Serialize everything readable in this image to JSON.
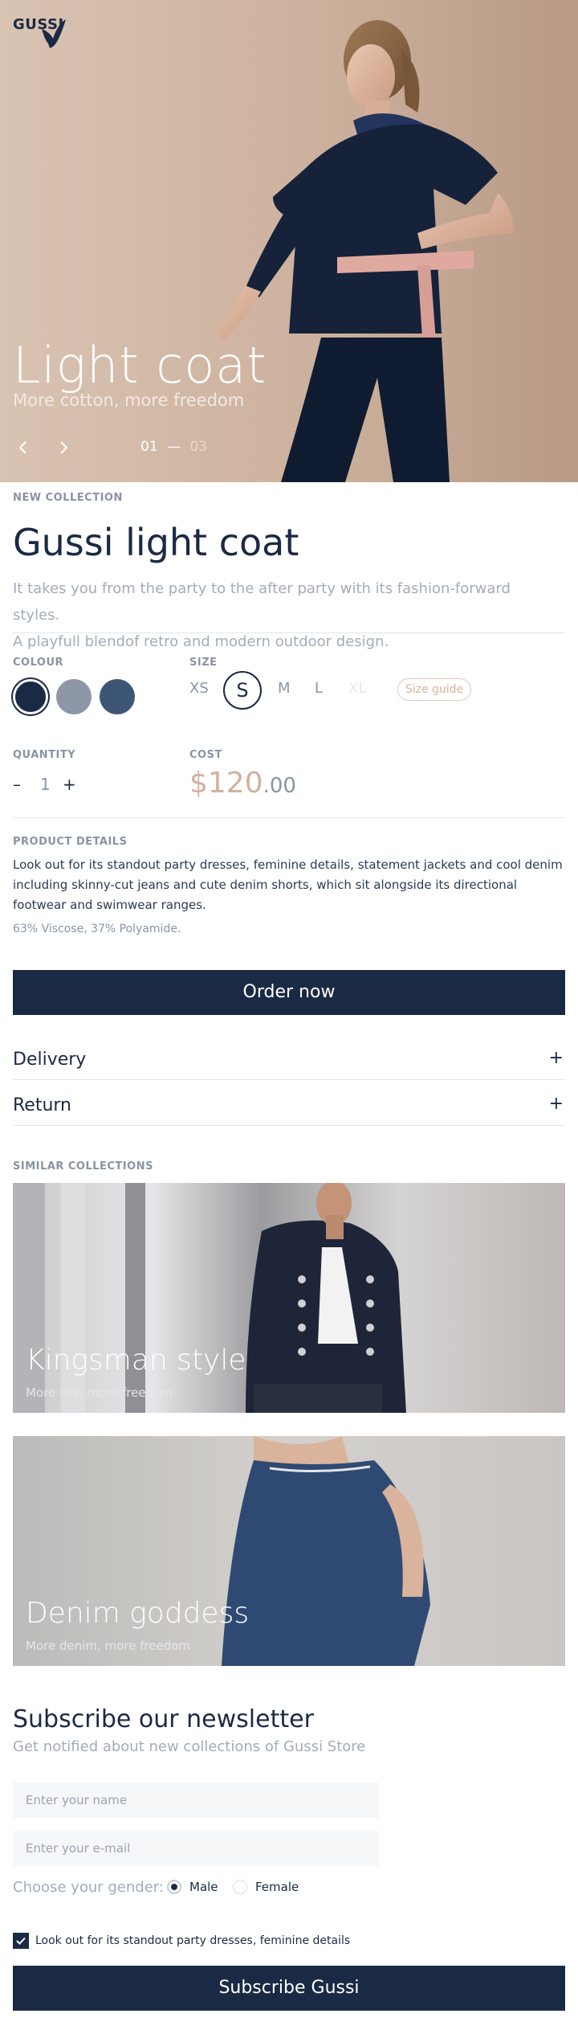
{
  "brand": {
    "name": "GUSSI"
  },
  "hero": {
    "title": "Light coat",
    "subtitle": "More cotton, more freedom",
    "current": "01",
    "separator": "—",
    "total": "03",
    "prev_icon": "chevron-left-icon",
    "next_icon": "chevron-right-icon"
  },
  "product": {
    "collection_label": "NEW COLLECTION",
    "title": "Gussi light coat",
    "description_1": "It takes you from the party to the after party  with its fashion-forward styles.",
    "description_2": "A playfull blendof retro and modern outdoor design."
  },
  "colour": {
    "label": "COLOUR",
    "swatches": [
      "#1b2a44",
      "#8e97a8",
      "#3e5675"
    ],
    "selected_index": 0
  },
  "size": {
    "label": "SIZE",
    "options": [
      "XS",
      "S",
      "M",
      "L",
      "XL"
    ],
    "selected": "S",
    "disabled": [
      "XL"
    ],
    "guide_label": "Size guide"
  },
  "quantity": {
    "label": "QUANTITY",
    "minus": "–",
    "value": "1",
    "plus": "+"
  },
  "cost": {
    "label": "COST",
    "main": "$120",
    "cents": ".00"
  },
  "details": {
    "label": "PRODUCT DETAILS",
    "text": "Look out for its standout party dresses, feminine details, statement jackets and cool denim including skinny-cut jeans and cute denim shorts, which sit alongside its directional footwear and swimwear ranges.",
    "material": "63% Viscose, 37% Polyamide."
  },
  "order_button": "Order now",
  "accordion": [
    {
      "title": "Delivery",
      "icon": "+"
    },
    {
      "title": "Return",
      "icon": "+"
    }
  ],
  "similar": {
    "label": "SIMILAR COLLECTIONS",
    "cards": [
      {
        "title": "Kingsman style",
        "subtitle": "More silk, more freedom"
      },
      {
        "title": "Denim goddess",
        "subtitle": "More denim, more freedom"
      }
    ]
  },
  "newsletter": {
    "title": "Subscribe our newsletter",
    "subtitle": "Get notified about new collections of Gussi Store",
    "name_placeholder": "Enter your name",
    "email_placeholder": "Enter your e-mail",
    "gender_label": "Choose your gender:",
    "gender_options": [
      "Male",
      "Female"
    ],
    "gender_selected": "Male",
    "checkbox_label": "Look out for its standout party dresses, feminine details",
    "checkbox_checked": true,
    "submit_label": "Subscribe Gussi"
  }
}
